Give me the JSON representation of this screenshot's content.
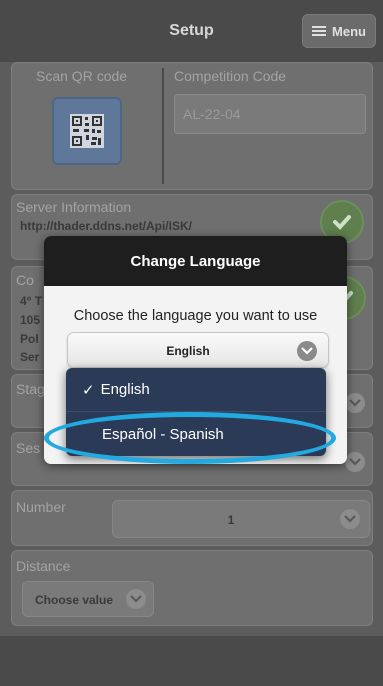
{
  "header": {
    "title": "Setup",
    "menu_label": "Menu"
  },
  "scan": {
    "label": "Scan QR code"
  },
  "competition": {
    "label": "Competition Code",
    "value": "AL-22-04"
  },
  "server": {
    "label": "Server Information",
    "url": "http://thader.ddns.net/Api/ISK/"
  },
  "competition_info": {
    "label_fragment": "Co",
    "lines": [
      "4° T",
      "105",
      "Pol",
      "Ser"
    ]
  },
  "stage": {
    "label_fragment": "Stag"
  },
  "session": {
    "label_fragment": "Ses"
  },
  "number": {
    "label": "Number",
    "value": "1"
  },
  "distance": {
    "label": "Distance",
    "select_label": "Choose value"
  },
  "modal": {
    "title": "Change Language",
    "prompt": "Choose the language you want to use",
    "selected": "English"
  },
  "dropdown": {
    "options": [
      {
        "label": "English",
        "checked": true
      },
      {
        "label": "Español - Spanish",
        "checked": false
      }
    ]
  },
  "colors": {
    "highlight": "#22a9e0",
    "dropdown_bg": "#2b3a57",
    "modal_header": "#1e1e1e"
  }
}
